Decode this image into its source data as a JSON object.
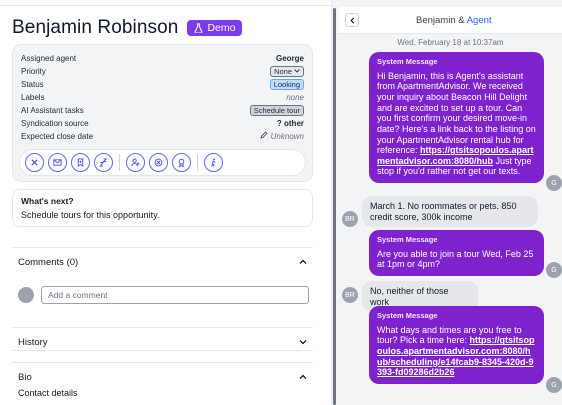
{
  "contact": {
    "name": "Benjamin Robinson",
    "badge": "Demo"
  },
  "details": {
    "rows": [
      {
        "label": "Assigned agent",
        "value": "George"
      },
      {
        "label": "Priority",
        "value": "None"
      },
      {
        "label": "Status",
        "value": "Looking"
      },
      {
        "label": "Labels",
        "value": "none"
      },
      {
        "label": "AI Assistant tasks",
        "value": "Schedule tour"
      },
      {
        "label": "Syndication source",
        "value": "other"
      },
      {
        "label": "Expected close date",
        "value": "Unknown"
      }
    ],
    "actions": [
      "close-icon",
      "mail-icon",
      "bookmark-icon",
      "snooze-icon",
      "add-user-icon",
      "block-icon",
      "award-icon",
      "walk-icon"
    ]
  },
  "next": {
    "title": "What's next?",
    "text": "Schedule tours for this opportunity."
  },
  "comments": {
    "title": "Comments (0)",
    "placeholder": "Add a comment"
  },
  "history": {
    "title": "History"
  },
  "bio": {
    "title": "Bio",
    "contact_details": "Contact details"
  },
  "chat": {
    "title_name": "Benjamin",
    "title_amp": "&",
    "title_agent": "Agent",
    "date": "Wed, February 18 at 10:37am",
    "messages": [
      {
        "dir": "out",
        "label": "System Message",
        "text": "Hi Benjamin, this is Agent's assistant from ApartmentAdvisor. We received your inquiry about Beacon Hill Delight and are excited to set up a tour. Can you first confirm your desired move-in date? Here's a link back to the listing on your ApartmentAdvisor rental hub for reference: ",
        "link": "https://gtsitsopoulos.apartmentadvisor.com:8080/hub",
        "after": " Just type stop if you'd rather not get our texts.",
        "avatar": "G"
      },
      {
        "dir": "in",
        "text": "March 1. No roommates or pets. 850 credit score, 300k income",
        "avatar": "BR"
      },
      {
        "dir": "out",
        "label": "System Message",
        "text": "Are you able to join a tour Wed, Feb 25 at 1pm or 4pm?",
        "avatar": "G"
      },
      {
        "dir": "in",
        "text": "No, neither of those work",
        "avatar": "BR"
      },
      {
        "dir": "out",
        "label": "System Message",
        "text": "What days and times are you free to tour? Pick a time here: ",
        "link": "https://gtsitsopoulos.apartmentadvisor.com:8080/hub/scheduling/e14fcab9-8345-420d-9393-fd09286d2b26",
        "avatar": "G"
      }
    ]
  },
  "colors": {
    "accent": "#7c3aed",
    "system_bubble": "#7e22ce",
    "link_blue": "#2563eb"
  }
}
